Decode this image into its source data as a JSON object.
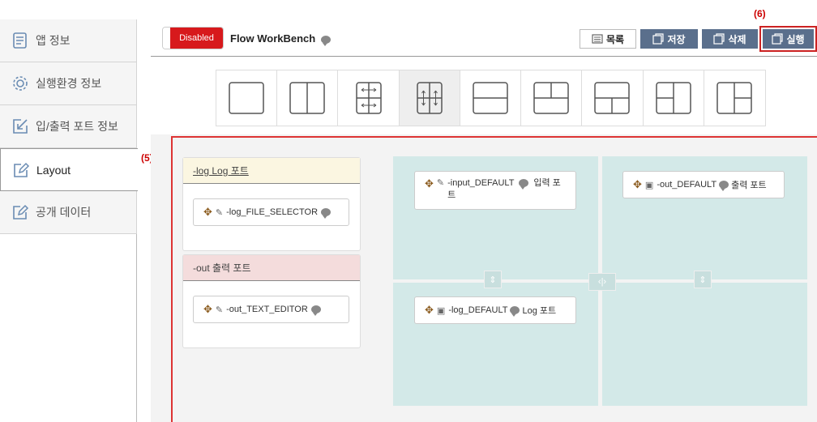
{
  "sidebar": {
    "items": [
      {
        "label": "앱 정보",
        "icon": "document-list-icon"
      },
      {
        "label": "실행환경 정보",
        "icon": "gear-icon"
      },
      {
        "label": "입/출력 포트 정보",
        "icon": "import-icon"
      },
      {
        "label": "Layout",
        "icon": "edit-icon"
      },
      {
        "label": "공개 데이터",
        "icon": "edit-icon"
      }
    ],
    "active_index": 3
  },
  "annotations": {
    "marker_5": "(5)",
    "marker_6": "(6)"
  },
  "header": {
    "toggle_label": "Disabled",
    "title": "Flow WorkBench",
    "buttons": {
      "list": "목록",
      "save": "저장",
      "delete": "삭제",
      "run": "실행"
    }
  },
  "layout_options": {
    "icons": [
      "single-pane-icon",
      "two-column-icon",
      "two-row-two-column-h-icon",
      "two-row-two-column-v-icon",
      "two-row-icon",
      "top-split-icon",
      "bottom-split-icon",
      "left-split-icon",
      "right-split-icon"
    ],
    "selected_index": 3
  },
  "ports": {
    "log_panel": {
      "header": "-log Log 포트",
      "item": "-log_FILE_SELECTOR"
    },
    "out_panel": {
      "header": "-out 출력 포트",
      "item": "-out_TEXT_EDITOR"
    }
  },
  "grid": {
    "top_left": {
      "line1": "-input_DEFAULT",
      "line1_suffix": "입력 포",
      "line2": "트"
    },
    "top_right": {
      "text": "-out_DEFAULT",
      "suffix": "출력 포트"
    },
    "bottom_left": {
      "text": "-log_DEFAULT",
      "suffix": "Log 포트"
    }
  },
  "colors": {
    "toggle_red": "#d7191c",
    "button_slate": "#5a6f8c",
    "grid_teal": "#d3e9e8",
    "annotation_red": "#cc0000"
  }
}
